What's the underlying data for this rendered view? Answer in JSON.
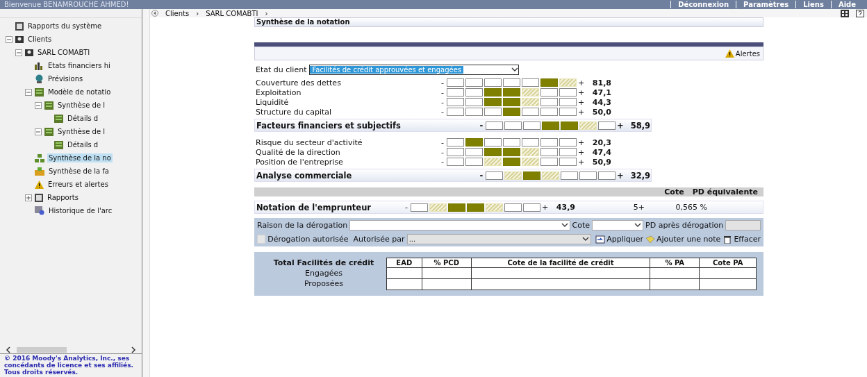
{
  "header": {
    "welcome": "Bienvenue BENAMROUCHE AHMED!",
    "links": [
      "Déconnexion",
      "Paramètres",
      "Liens",
      "Aide"
    ]
  },
  "breadcrumb": [
    {
      "label": "Clients",
      "separator": "›"
    },
    {
      "label": "SARL COMABTI",
      "separator": "›"
    }
  ],
  "sidebar": {
    "items": [
      {
        "label": "Rapports du système",
        "kind": "report",
        "selected": false
      },
      {
        "label": "Clients",
        "kind": "client",
        "expanded": true,
        "selected": false,
        "children": [
          {
            "label": "SARL COMABTI",
            "kind": "client",
            "expanded": true,
            "selected": false,
            "children": [
              {
                "label": "Etats financiers hi",
                "kind": "financials",
                "selected": false
              },
              {
                "label": "Prévisions",
                "kind": "forecast",
                "selected": false
              },
              {
                "label": "Modèle de notatio",
                "kind": "model",
                "expanded": true,
                "selected": false,
                "children": [
                  {
                    "label": "Synthèse de l",
                    "kind": "model",
                    "expanded": true,
                    "selected": false,
                    "children": [
                      {
                        "label": "Détails d",
                        "kind": "model",
                        "selected": false
                      }
                    ]
                  },
                  {
                    "label": "Synthèse de l",
                    "kind": "model",
                    "expanded": true,
                    "selected": false,
                    "children": [
                      {
                        "label": "Détails d",
                        "kind": "model",
                        "selected": false
                      }
                    ]
                  }
                ]
              },
              {
                "label": "Synthèse de la no",
                "kind": "rating",
                "selected": true
              },
              {
                "label": "Synthèse de la fa",
                "kind": "facility",
                "selected": false
              },
              {
                "label": "Erreurs et alertes",
                "kind": "alert",
                "selected": false
              },
              {
                "label": "Rapports",
                "kind": "report",
                "expanded": false,
                "selected": false
              },
              {
                "label": "Historique de l'arc",
                "kind": "history",
                "selected": false
              }
            ]
          }
        ]
      }
    ],
    "copyright": "© 2016 Moody's Analytics, Inc., ses concédants de licence et ses affiliés. Tous droits réservés."
  },
  "main": {
    "title": "Synthèse de la notation",
    "alerts": "Alertes",
    "client_state_label": "Etat du client",
    "client_state": "Facilités de crédit approuvées et engagées",
    "factors": [
      {
        "kind": "item",
        "label": "Couverture des dettes",
        "minus": "-",
        "plus": "+",
        "cells": [
          {
            "solid": false,
            "hatched": false
          },
          {
            "solid": false,
            "hatched": false
          },
          {
            "solid": false,
            "hatched": false
          },
          {
            "solid": false,
            "hatched": false
          },
          {
            "solid": false,
            "hatched": false
          },
          {
            "solid": true,
            "hatched": false
          },
          {
            "solid": false,
            "hatched": true
          }
        ],
        "score": "81,8"
      },
      {
        "kind": "item",
        "label": "Exploitation",
        "minus": "-",
        "plus": "+",
        "cells": [
          {
            "solid": false,
            "hatched": false
          },
          {
            "solid": false,
            "hatched": false
          },
          {
            "solid": true,
            "hatched": false
          },
          {
            "solid": true,
            "hatched": false
          },
          {
            "solid": false,
            "hatched": true
          },
          {
            "solid": false,
            "hatched": false
          },
          {
            "solid": false,
            "hatched": false
          }
        ],
        "score": "47,1"
      },
      {
        "kind": "item",
        "label": "Liquidité",
        "minus": "-",
        "plus": "+",
        "cells": [
          {
            "solid": false,
            "hatched": false
          },
          {
            "solid": false,
            "hatched": false
          },
          {
            "solid": true,
            "hatched": false
          },
          {
            "solid": true,
            "hatched": false
          },
          {
            "solid": false,
            "hatched": true
          },
          {
            "solid": false,
            "hatched": false
          },
          {
            "solid": false,
            "hatched": false
          }
        ],
        "score": "44,3"
      },
      {
        "kind": "item",
        "label": "Structure du capital",
        "minus": "-",
        "plus": "+",
        "cells": [
          {
            "solid": false,
            "hatched": false
          },
          {
            "solid": false,
            "hatched": false
          },
          {
            "solid": false,
            "hatched": false
          },
          {
            "solid": true,
            "hatched": false
          },
          {
            "solid": false,
            "hatched": false
          },
          {
            "solid": false,
            "hatched": false
          },
          {
            "solid": false,
            "hatched": false
          }
        ],
        "score": "50,0"
      },
      {
        "kind": "total",
        "label": "Facteurs financiers et subjectifs",
        "minus": "-",
        "plus": "+",
        "cells": [
          {
            "solid": false,
            "hatched": false
          },
          {
            "solid": false,
            "hatched": false
          },
          {
            "solid": false,
            "hatched": false
          },
          {
            "solid": true,
            "hatched": false
          },
          {
            "solid": true,
            "hatched": false
          },
          {
            "solid": false,
            "hatched": true
          },
          {
            "solid": false,
            "hatched": false
          }
        ],
        "score": "58,9"
      },
      {
        "kind": "item",
        "label": "Risque du secteur d'activité",
        "minus": "-",
        "plus": "+",
        "cells": [
          {
            "solid": false,
            "hatched": false
          },
          {
            "solid": true,
            "hatched": false
          },
          {
            "solid": false,
            "hatched": false
          },
          {
            "solid": false,
            "hatched": false
          },
          {
            "solid": false,
            "hatched": false
          },
          {
            "solid": false,
            "hatched": false
          },
          {
            "solid": false,
            "hatched": false
          }
        ],
        "score": "20,3"
      },
      {
        "kind": "item",
        "label": "Qualité de la direction",
        "minus": "-",
        "plus": "+",
        "cells": [
          {
            "solid": false,
            "hatched": false
          },
          {
            "solid": false,
            "hatched": false
          },
          {
            "solid": true,
            "hatched": false
          },
          {
            "solid": true,
            "hatched": false
          },
          {
            "solid": false,
            "hatched": true
          },
          {
            "solid": false,
            "hatched": false
          },
          {
            "solid": false,
            "hatched": false
          }
        ],
        "score": "47,4"
      },
      {
        "kind": "item",
        "label": "Position de l'entreprise",
        "minus": "-",
        "plus": "+",
        "cells": [
          {
            "solid": false,
            "hatched": false
          },
          {
            "solid": false,
            "hatched": false
          },
          {
            "solid": false,
            "hatched": true
          },
          {
            "solid": true,
            "hatched": false
          },
          {
            "solid": false,
            "hatched": true
          },
          {
            "solid": false,
            "hatched": false
          },
          {
            "solid": false,
            "hatched": false
          }
        ],
        "score": "50,9"
      },
      {
        "kind": "total",
        "label": "Analyse commerciale",
        "minus": "-",
        "plus": "+",
        "cells": [
          {
            "solid": false,
            "hatched": false
          },
          {
            "solid": false,
            "hatched": true
          },
          {
            "solid": true,
            "hatched": false
          },
          {
            "solid": false,
            "hatched": true
          },
          {
            "solid": false,
            "hatched": false
          },
          {
            "solid": false,
            "hatched": false
          },
          {
            "solid": false,
            "hatched": false
          }
        ],
        "score": "32,9"
      }
    ],
    "rating_headers": [
      "Cote",
      "PD équivalente"
    ],
    "borrower": {
      "label": "Notation de l'emprunteur",
      "minus": "-",
      "plus": "+",
      "cells": [
        {
          "solid": false,
          "hatched": false
        },
        {
          "solid": false,
          "hatched": true
        },
        {
          "solid": true,
          "hatched": false
        },
        {
          "solid": true,
          "hatched": false
        },
        {
          "solid": false,
          "hatched": true
        },
        {
          "solid": false,
          "hatched": false
        },
        {
          "solid": false,
          "hatched": false
        }
      ],
      "score": "43,9",
      "grade": "5+",
      "pd": "0,565 %"
    },
    "override": {
      "reason_label": "Raison de la dérogation",
      "grade_label": "Cote",
      "pd_label": "PD après dérogation",
      "authorized_label": "Dérogation autorisée",
      "authorized": false,
      "by_label": "Autorisée par",
      "by_value": "...",
      "actions": [
        "Appliquer",
        "Ajouter une note",
        "Effacer"
      ]
    },
    "facilities": {
      "title": "Total Facilités de crédit",
      "columns": [
        "EAD",
        "% PCD",
        "Cote de la facilité de crédit",
        "% PA",
        "Cote PA"
      ],
      "rows": [
        "Engagées",
        "Proposées"
      ]
    }
  }
}
